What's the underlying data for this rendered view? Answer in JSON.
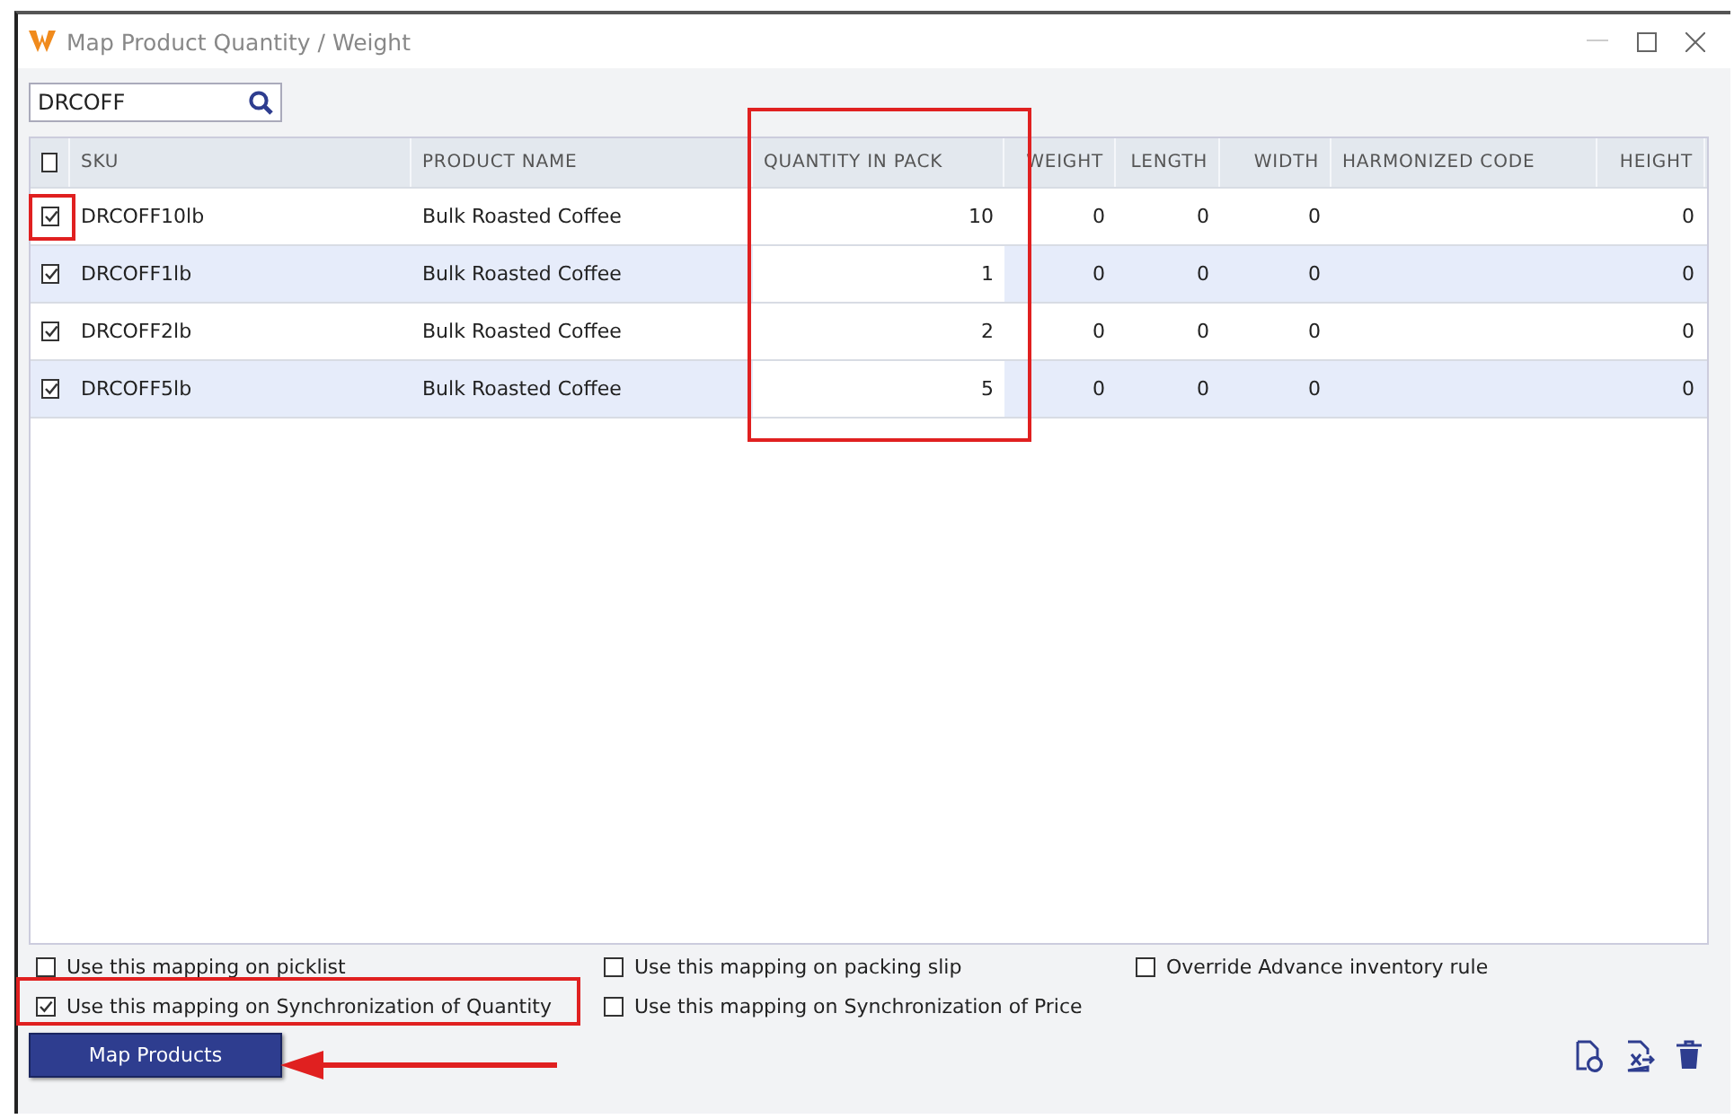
{
  "window": {
    "title": "Map Product Quantity / Weight"
  },
  "search": {
    "value": "DRCOFF"
  },
  "table": {
    "select_all": {
      "checked": false
    },
    "columns": [
      {
        "label": "SKU",
        "kind": "text"
      },
      {
        "label": "PRODUCT NAME",
        "kind": "text"
      },
      {
        "label": "QUANTITY IN PACK",
        "kind": "quantity"
      },
      {
        "label": "WEIGHT",
        "kind": "number"
      },
      {
        "label": "LENGTH",
        "kind": "number"
      },
      {
        "label": "WIDTH",
        "kind": "number"
      },
      {
        "label": "HARMONIZED CODE",
        "kind": "text"
      },
      {
        "label": "HEIGHT",
        "kind": "number"
      }
    ],
    "rows": [
      {
        "checked": true,
        "cells": [
          "DRCOFF10lb",
          "Bulk Roasted Coffee",
          "10",
          "0",
          "0",
          "0",
          "",
          "0"
        ]
      },
      {
        "checked": true,
        "cells": [
          "DRCOFF1lb",
          "Bulk Roasted Coffee",
          "1",
          "0",
          "0",
          "0",
          "",
          "0"
        ]
      },
      {
        "checked": true,
        "cells": [
          "DRCOFF2lb",
          "Bulk Roasted Coffee",
          "2",
          "0",
          "0",
          "0",
          "",
          "0"
        ]
      },
      {
        "checked": true,
        "cells": [
          "DRCOFF5lb",
          "Bulk Roasted Coffee",
          "5",
          "0",
          "0",
          "0",
          "",
          "0"
        ]
      }
    ]
  },
  "options": [
    {
      "label": "Use this mapping on picklist",
      "checked": false
    },
    {
      "label": "Use this mapping on packing slip",
      "checked": false
    },
    {
      "label": "Override Advance inventory rule",
      "checked": false
    },
    {
      "label": "Use this mapping on Synchronization of Quantity",
      "checked": true
    },
    {
      "label": "Use this mapping on Synchronization of Price",
      "checked": false
    }
  ],
  "map_button": {
    "label": "Map Products"
  }
}
